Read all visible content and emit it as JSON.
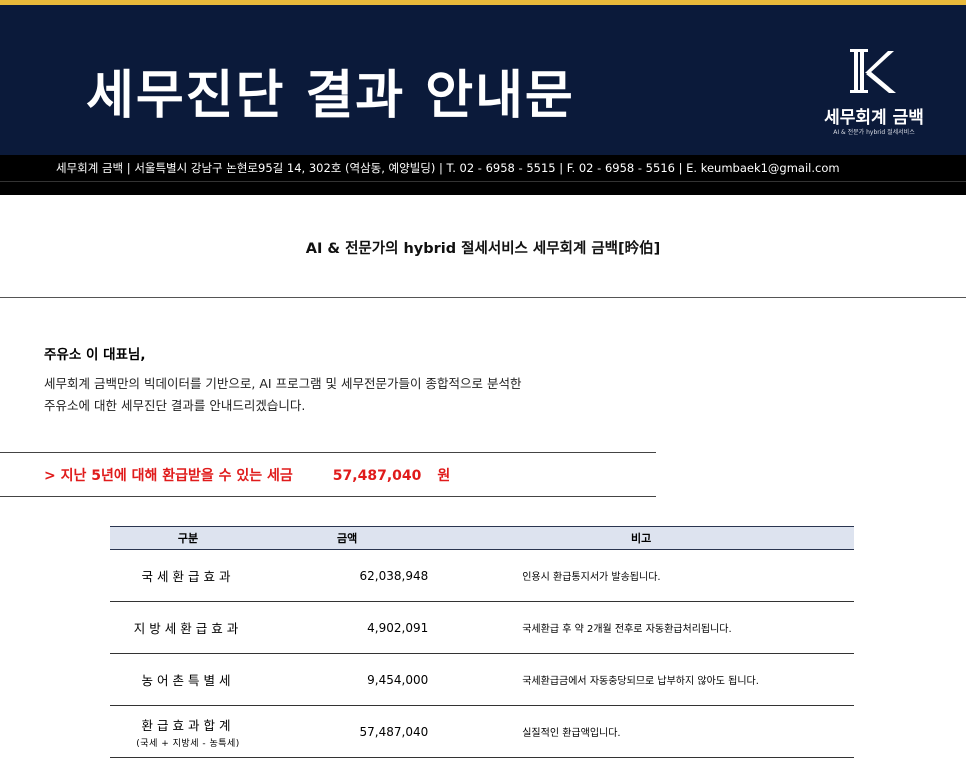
{
  "header": {
    "title": "세무진단 결과 안내문",
    "logo_name": "세무회계 금백",
    "logo_sub": "AI & 전문가 hybrid 절세서비스"
  },
  "infobar": {
    "text": "세무회계 금백  |  서울특별시 강남구 논현로95길 14, 302호 (역삼동, 예양빌딩)  |  T. 02 - 6958 - 5515  |  F. 02 - 6958 - 5516 | E. keumbaek1@gmail.com"
  },
  "subtitle": "AI & 전문가의 hybrid 절세서비스 세무회계 금백[昑伯]",
  "greeting": "주유소 이  대표님,",
  "body": {
    "line1": "세무회계 금백만의 빅데이터를 기반으로, AI 프로그램 및 세무전문가들이 종합적으로 분석한",
    "line2": "주유소에 대한 세무진단 결과를 안내드리겠습니다."
  },
  "refund": {
    "label": "> 지난 5년에 대해 환급받을 수 있는 세금",
    "amount": "57,487,040",
    "unit": "원"
  },
  "table": {
    "headers": [
      "구분",
      "금액",
      "비고"
    ],
    "rows": [
      {
        "label": "국세환급효과",
        "sub": "",
        "amount": "62,038,948",
        "note": "인용시 환급통지서가 발송됩니다."
      },
      {
        "label": "지방세환급효과",
        "sub": "",
        "amount": "4,902,091",
        "note": "국세환급 후 약 2개월 전후로 자동환급처리됩니다."
      },
      {
        "label": "농어촌특별세",
        "sub": "",
        "amount": "9,454,000",
        "note": "국세환급금에서 자동충당되므로 납부하지 않아도 됩니다."
      },
      {
        "label": "환급효과합계",
        "sub": "(국세 + 지방세 - 농특세)",
        "amount": "57,487,040",
        "note": "실질적인 환급액입니다."
      }
    ]
  }
}
